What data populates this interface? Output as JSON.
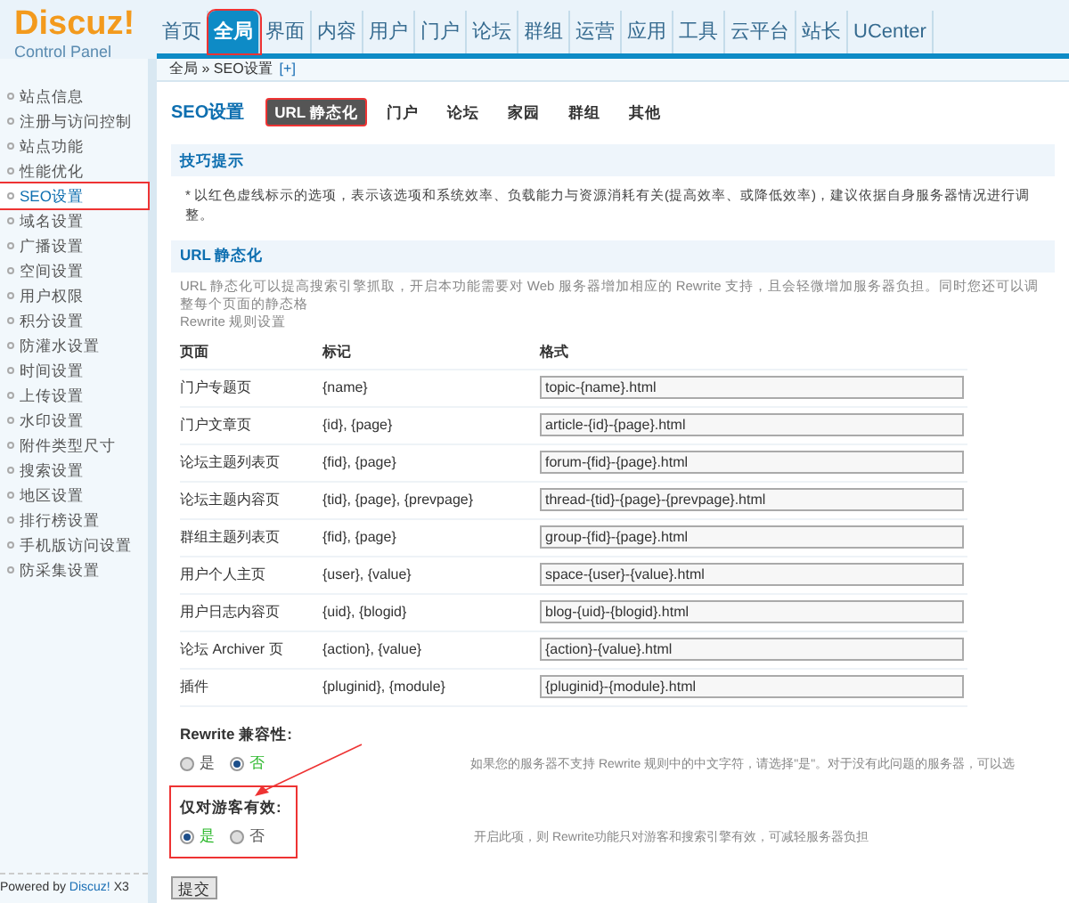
{
  "logo": {
    "title": "Discuz!",
    "subtitle": "Control Panel"
  },
  "nav": [
    {
      "label": "首页",
      "selected": false,
      "annotated": false
    },
    {
      "label": "全局",
      "selected": true,
      "annotated": true
    },
    {
      "label": "界面",
      "selected": false,
      "annotated": false
    },
    {
      "label": "内容",
      "selected": false,
      "annotated": false
    },
    {
      "label": "用户",
      "selected": false,
      "annotated": false
    },
    {
      "label": "门户",
      "selected": false,
      "annotated": false
    },
    {
      "label": "论坛",
      "selected": false,
      "annotated": false
    },
    {
      "label": "群组",
      "selected": false,
      "annotated": false
    },
    {
      "label": "运营",
      "selected": false,
      "annotated": false
    },
    {
      "label": "应用",
      "selected": false,
      "annotated": false
    },
    {
      "label": "工具",
      "selected": false,
      "annotated": false
    },
    {
      "label": "云平台",
      "selected": false,
      "annotated": false
    },
    {
      "label": "站长",
      "selected": false,
      "annotated": false
    },
    {
      "label": "UCenter",
      "selected": false,
      "annotated": false
    }
  ],
  "breadcrumb": {
    "path": "全局 » SEO设置",
    "add": "[+]"
  },
  "sidebar": {
    "items": [
      {
        "label": "站点信息",
        "selected": false,
        "annotated": false
      },
      {
        "label": "注册与访问控制",
        "selected": false,
        "annotated": false
      },
      {
        "label": "站点功能",
        "selected": false,
        "annotated": false
      },
      {
        "label": "性能优化",
        "selected": false,
        "annotated": false
      },
      {
        "label": "SEO设置",
        "selected": true,
        "annotated": true
      },
      {
        "label": "域名设置",
        "selected": false,
        "annotated": false
      },
      {
        "label": "广播设置",
        "selected": false,
        "annotated": false
      },
      {
        "label": "空间设置",
        "selected": false,
        "annotated": false
      },
      {
        "label": "用户权限",
        "selected": false,
        "annotated": false
      },
      {
        "label": "积分设置",
        "selected": false,
        "annotated": false
      },
      {
        "label": "防灌水设置",
        "selected": false,
        "annotated": false
      },
      {
        "label": "时间设置",
        "selected": false,
        "annotated": false
      },
      {
        "label": "上传设置",
        "selected": false,
        "annotated": false
      },
      {
        "label": "水印设置",
        "selected": false,
        "annotated": false
      },
      {
        "label": "附件类型尺寸",
        "selected": false,
        "annotated": false
      },
      {
        "label": "搜索设置",
        "selected": false,
        "annotated": false
      },
      {
        "label": "地区设置",
        "selected": false,
        "annotated": false
      },
      {
        "label": "排行榜设置",
        "selected": false,
        "annotated": false
      },
      {
        "label": "手机版访问设置",
        "selected": false,
        "annotated": false
      },
      {
        "label": "防采集设置",
        "selected": false,
        "annotated": false
      }
    ],
    "footer": {
      "prefix": "Powered by",
      "link": "Discuz!",
      "suffix": "X3"
    }
  },
  "page_title": "SEO设置",
  "tabs": [
    {
      "label": "URL 静态化",
      "selected": true,
      "annotated": true
    },
    {
      "label": "门户",
      "selected": false,
      "annotated": false
    },
    {
      "label": "论坛",
      "selected": false,
      "annotated": false
    },
    {
      "label": "家园",
      "selected": false,
      "annotated": false
    },
    {
      "label": "群组",
      "selected": false,
      "annotated": false
    },
    {
      "label": "其他",
      "selected": false,
      "annotated": false
    }
  ],
  "tips": {
    "title": "技巧提示",
    "marker": "*",
    "text": "以红色虚线标示的选项，表示该选项和系统效率、负载能力与资源消耗有关(提高效率、或降低效率)，建议依据自身服务器情况进行调整。"
  },
  "url_section": {
    "title": "URL 静态化",
    "description": "URL 静态化可以提高搜索引擎抓取，开启本功能需要对 Web 服务器增加相应的 Rewrite 支持，且会轻微增加服务器负担。同时您还可以调整每个页面的静态格",
    "description_2": "Rewrite 规则设置"
  },
  "table": {
    "columns": [
      "页面",
      "标记",
      "格式"
    ],
    "rows": [
      {
        "page": "门户专题页",
        "marks": "{name}",
        "format": "topic-{name}.html"
      },
      {
        "page": "门户文章页",
        "marks": "{id}, {page}",
        "format": "article-{id}-{page}.html"
      },
      {
        "page": "论坛主题列表页",
        "marks": "{fid}, {page}",
        "format": "forum-{fid}-{page}.html"
      },
      {
        "page": "论坛主题内容页",
        "marks": "{tid}, {page}, {prevpage}",
        "format": "thread-{tid}-{page}-{prevpage}.html"
      },
      {
        "page": "群组主题列表页",
        "marks": "{fid}, {page}",
        "format": "group-{fid}-{page}.html"
      },
      {
        "page": "用户个人主页",
        "marks": "{user}, {value}",
        "format": "space-{user}-{value}.html"
      },
      {
        "page": "用户日志内容页",
        "marks": "{uid}, {blogid}",
        "format": "blog-{uid}-{blogid}.html"
      },
      {
        "page": "论坛 Archiver 页",
        "marks": "{action}, {value}",
        "format": "{action}-{value}.html"
      },
      {
        "page": "插件",
        "marks": "{pluginid}, {module}",
        "format": "{pluginid}-{module}.html"
      }
    ]
  },
  "settings": [
    {
      "label": "Rewrite 兼容性:",
      "annotated": false,
      "options": [
        {
          "label": "是",
          "selected": false
        },
        {
          "label": "否",
          "selected": true
        }
      ],
      "note": "如果您的服务器不支持 Rewrite 规则中的中文字符，请选择\"是\"。对于没有此问题的服务器，可以选"
    },
    {
      "label": "仅对游客有效:",
      "annotated": true,
      "options": [
        {
          "label": "是",
          "selected": true
        },
        {
          "label": "否",
          "selected": false
        }
      ],
      "note": "开启此项，则 Rewrite功能只对游客和搜索引擎有效，可减轻服务器负担"
    }
  ],
  "submit": "提交"
}
